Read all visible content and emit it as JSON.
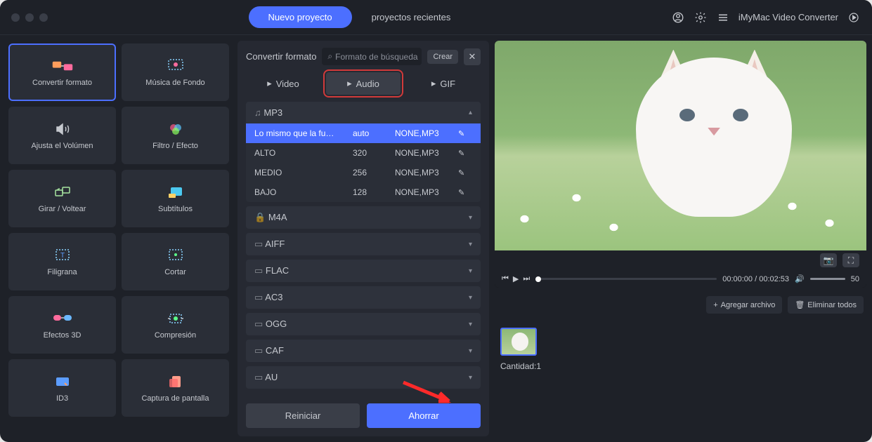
{
  "titlebar": {
    "tabs": {
      "new": "Nuevo proyecto",
      "recent": "proyectos recientes"
    },
    "app_name": "iMyMac Video Converter"
  },
  "sidebar": {
    "items": [
      {
        "label": "Convertir formato"
      },
      {
        "label": "Música de Fondo"
      },
      {
        "label": "Ajusta el Volúmen"
      },
      {
        "label": "Filtro / Efecto"
      },
      {
        "label": "Girar / Voltear"
      },
      {
        "label": "Subtítulos"
      },
      {
        "label": "Filigrana"
      },
      {
        "label": "Cortar"
      },
      {
        "label": "Efectos 3D"
      },
      {
        "label": "Compresión"
      },
      {
        "label": "ID3"
      },
      {
        "label": "Captura de pantalla"
      }
    ]
  },
  "center": {
    "title": "Convertir formato",
    "search_placeholder": "Formato de búsqueda",
    "create": "Crear",
    "tabs": {
      "video": "Video",
      "audio": "Audio",
      "gif": "GIF"
    },
    "groups": [
      "MP3",
      "M4A",
      "AIFF",
      "FLAC",
      "AC3",
      "OGG",
      "CAF",
      "AU"
    ],
    "presets": [
      {
        "name": "Lo mismo que la fu…",
        "br": "auto",
        "codec": "NONE,MP3"
      },
      {
        "name": "ALTO",
        "br": "320",
        "codec": "NONE,MP3"
      },
      {
        "name": "MEDIO",
        "br": "256",
        "codec": "NONE,MP3"
      },
      {
        "name": "BAJO",
        "br": "128",
        "codec": "NONE,MP3"
      }
    ],
    "reset": "Reiniciar",
    "save": "Ahorrar"
  },
  "player": {
    "time_current": "00:00:00",
    "time_total": "00:02:53",
    "volume": "50"
  },
  "queue": {
    "add_file": "Agregar archivo",
    "remove_all": "Eliminar todos",
    "qty": "Cantidad:1"
  }
}
